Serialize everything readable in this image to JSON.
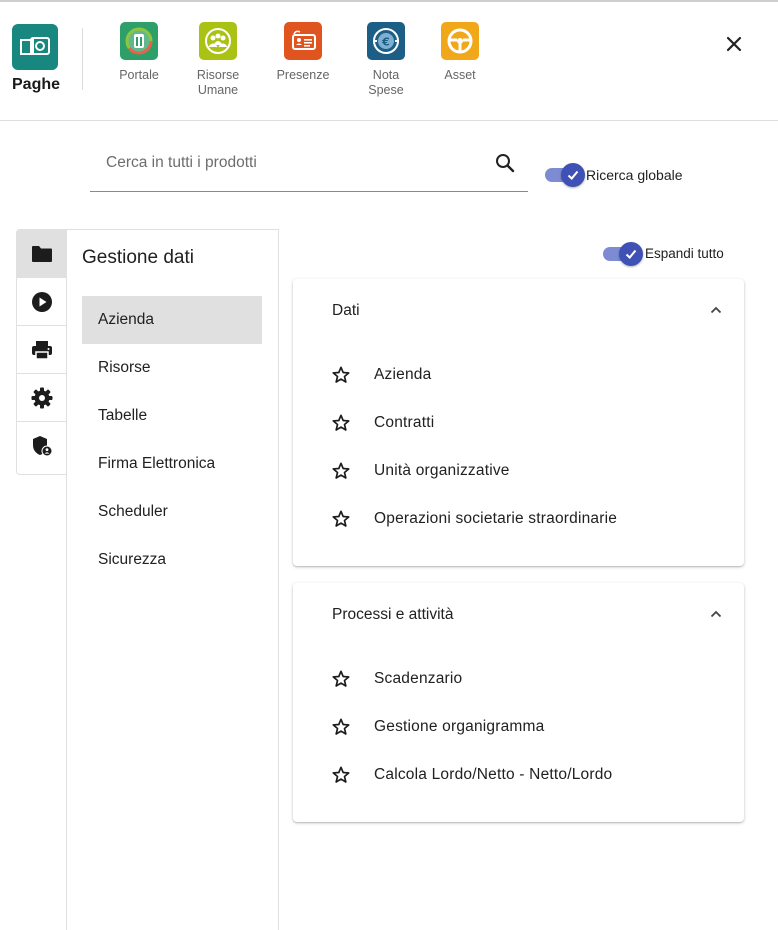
{
  "header": {
    "brand": {
      "name": "Paghe",
      "icon": "paghe-logo-icon"
    },
    "apps": [
      {
        "label": "Portale",
        "icon": "portale-icon",
        "color": "#7bbf3a"
      },
      {
        "label": "Risorse\nUmane",
        "icon": "risorse-umane-icon",
        "color": "#b5cc1a"
      },
      {
        "label": "Presenze",
        "icon": "presenze-icon",
        "color": "#e0541f"
      },
      {
        "label": "Nota\nSpese",
        "icon": "nota-spese-icon",
        "color": "#1f5f86"
      },
      {
        "label": "Asset",
        "icon": "asset-icon",
        "color": "#f0a81a"
      }
    ],
    "close_icon": "close-icon"
  },
  "search": {
    "placeholder": "Cerca in tutti i prodotti",
    "value": "",
    "global_toggle_label": "Ricerca globale",
    "global_toggle_on": true
  },
  "rail": [
    {
      "icon": "folder-icon",
      "active": true
    },
    {
      "icon": "play-circle-icon",
      "active": false
    },
    {
      "icon": "printer-icon",
      "active": false
    },
    {
      "icon": "gear-icon",
      "active": false
    },
    {
      "icon": "shield-user-icon",
      "active": false
    }
  ],
  "nav": {
    "title": "Gestione dati",
    "items": [
      {
        "label": "Azienda",
        "active": true
      },
      {
        "label": "Risorse",
        "active": false
      },
      {
        "label": "Tabelle",
        "active": false
      },
      {
        "label": "Firma Elettronica",
        "active": false
      },
      {
        "label": "Scheduler",
        "active": false
      },
      {
        "label": "Sicurezza",
        "active": false
      }
    ]
  },
  "expand_all": {
    "label": "Espandi tutto",
    "on": true
  },
  "sections": [
    {
      "title": "Dati",
      "expanded": true,
      "items": [
        "Azienda",
        "Contratti",
        "Unità organizzative",
        "Operazioni societarie straordinarie"
      ]
    },
    {
      "title": "Processi e attività",
      "expanded": true,
      "items": [
        "Scadenzario",
        "Gestione organigramma",
        "Calcola Lordo/Netto - Netto/Lordo"
      ]
    }
  ],
  "colors": {
    "accent": "#3f51b5",
    "accent_track": "#7d8bd3",
    "active_bg": "#e0e0e0",
    "brand_teal": "#17877f"
  }
}
